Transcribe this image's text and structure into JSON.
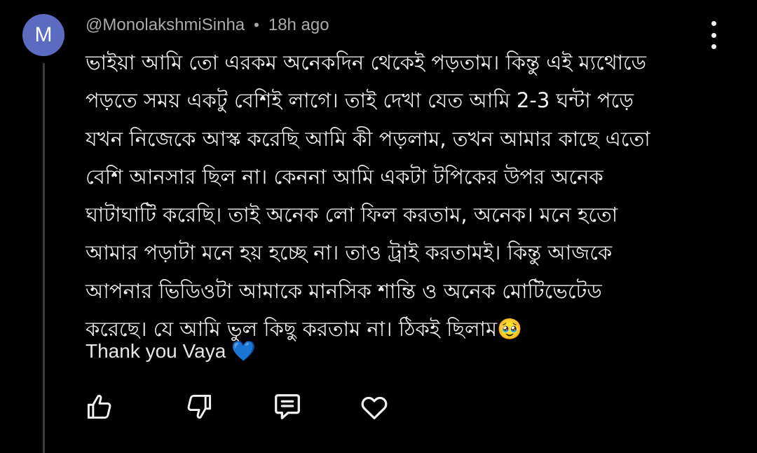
{
  "comment": {
    "avatar_initial": "M",
    "avatar_color": "#5c6bc0",
    "author": "@MonolakshmiSinha",
    "separator": "•",
    "time": "18h ago",
    "body_lines": [
      "ভাইয়া আমি তো এরকম অনেকদিন থেকেই পড়তাম। কিন্তু এই ম্যথোডে",
      "পড়তে সময় একটু বেশিই লাগে। তাই দেখা যেত আমি 2-3 ঘন্টা পড়ে",
      "যখন নিজেকে আস্ক করেছি আমি কী পড়লাম, তখন আমার কাছে এতো",
      "বেশি আনসার ছিল না। কেননা আমি একটা টপিকের উপর অনেক",
      "ঘাটাঘাটি করেছি। তাই অনেক লো ফিল করতাম, অনেক। মনে হতো",
      "আমার পড়াটা মনে হয় হচ্ছে না। তাও ট্রাই করতামই। কিন্তু আজকে",
      "আপনার ভিডিওটা আমাকে মানসিক শান্তি ও অনেক মোটিভেটেড",
      "করেছে। যে আমি ভুল কিছু করতাম না। ঠিকই ছিলাম🥹"
    ],
    "thanks_line": "Thank you Vaya 💙",
    "actions": [
      {
        "icon": "like-icon"
      },
      {
        "icon": "dislike-icon"
      },
      {
        "icon": "reply-icon"
      },
      {
        "icon": "heart-icon"
      }
    ],
    "more_icon": "more-vertical-icon"
  }
}
